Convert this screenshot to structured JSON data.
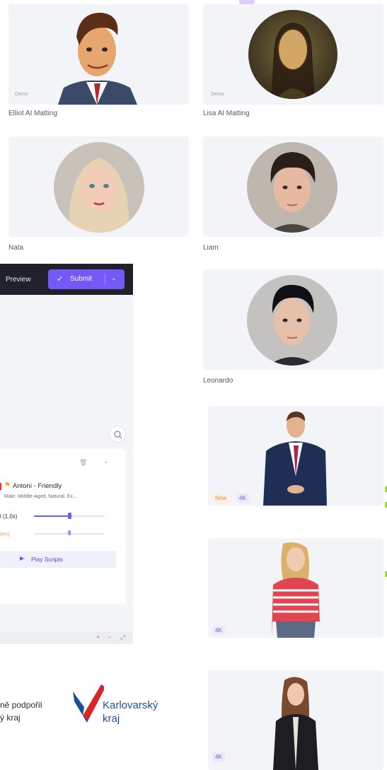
{
  "cards": [
    {
      "name": "Elliot AI Matting",
      "demo": "Demo"
    },
    {
      "name": "Lisa AI Matting",
      "demo": "Demo"
    },
    {
      "name": "Nata"
    },
    {
      "name": "Liam"
    },
    {
      "name": "Leonardo"
    }
  ],
  "video_cards": [
    {
      "badges": [
        "New",
        "4K"
      ]
    },
    {
      "badges": [
        "4K"
      ]
    },
    {
      "badges": [
        "4K"
      ]
    }
  ],
  "editor": {
    "preview_label": "Preview",
    "submit_label": "Submit",
    "voice": {
      "name": "Antoni - Friendly",
      "description": "Male, Middle-Aged, Natural, Ex..."
    },
    "speed_label": "l (1.0x)",
    "pitch_label": "0%)",
    "speed_value": 0.6,
    "pitch_value": 0.65,
    "play_label": "Play Scripts",
    "zoom_controls": [
      "+",
      "−",
      "⤢"
    ]
  },
  "footer": {
    "support_line1": "ně podpořil",
    "support_line2": "ý kraj",
    "logo_line1": "Karlovarský",
    "logo_line2": "kraj"
  },
  "colors": {
    "accent": "#7459f7",
    "editor_topbar": "#20212a",
    "card_bg": "#f3f4f7",
    "logo_blue": "#1f4f9c",
    "logo_red": "#d8232a",
    "new_badge": "#f08a3c"
  }
}
